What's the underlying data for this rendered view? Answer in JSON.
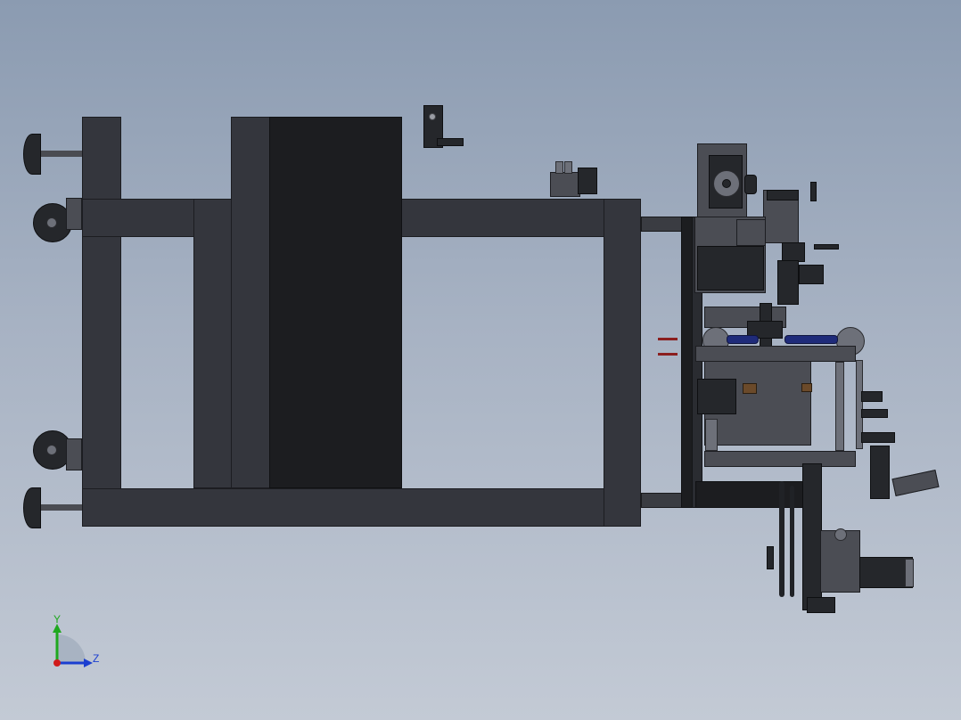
{
  "viewport": {
    "background_top": "#8b9bb1",
    "background_bottom": "#c3cad5",
    "model_color": "#34363d"
  },
  "triad": {
    "y_label": "Y",
    "z_label": "Z",
    "y_color": "#1fa81f",
    "z_color": "#1b3fd0",
    "x_color": "#d01b1b"
  }
}
